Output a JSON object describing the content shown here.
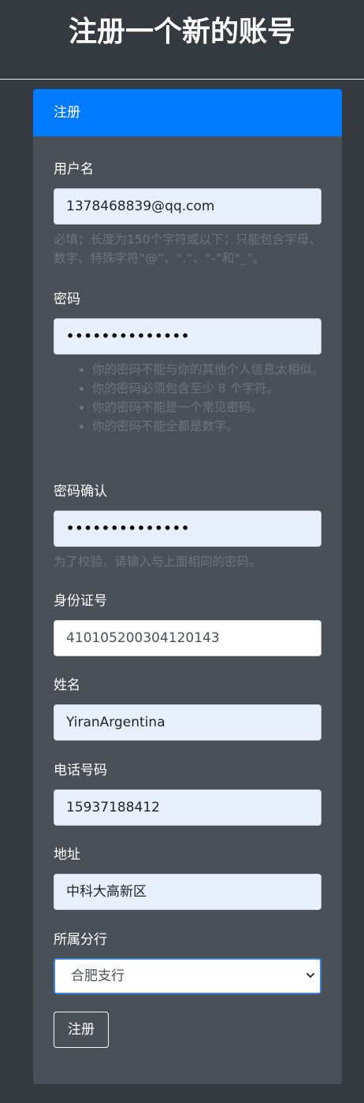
{
  "page_title": "注册一个新的账号",
  "card": {
    "header": "注册"
  },
  "form": {
    "username": {
      "label": "用户名",
      "value": "1378468839@qq.com",
      "help": "必填；长度为150个字符或以下；只能包含字母、数字、特殊字符“@”、“.”、“-”和“_”。"
    },
    "password": {
      "label": "密码",
      "value": "••••••••••••••",
      "help": [
        "你的密码不能与你的其他个人信息太相似。",
        "你的密码必须包含至少 8 个字符。",
        "你的密码不能是一个常见密码。",
        "你的密码不能全都是数字。"
      ]
    },
    "password_confirm": {
      "label": "密码确认",
      "value": "••••••••••••••",
      "help": "为了校验，请输入与上面相同的密码。"
    },
    "id_number": {
      "label": "身份证号",
      "value": "410105200304120143"
    },
    "name": {
      "label": "姓名",
      "value": "YiranArgentina"
    },
    "phone": {
      "label": "电话号码",
      "value": "15937188412"
    },
    "address": {
      "label": "地址",
      "value": "中科大高新区"
    },
    "branch": {
      "label": "所属分行",
      "selected": "合肥支行"
    },
    "submit_label": "注册"
  },
  "icons": {
    "select_arrow": "chevron-down-icon"
  },
  "colors": {
    "background": "#343a40",
    "card": "#495057",
    "header": "#007bff",
    "help_text": "#6c757d",
    "autofill_input": "#e8f0fe"
  }
}
